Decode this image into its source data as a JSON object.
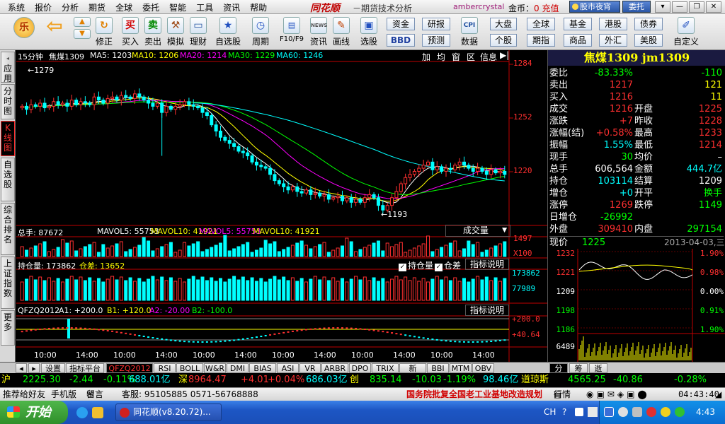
{
  "menubar": {
    "items": [
      "系统",
      "报价",
      "分析",
      "期货",
      "全球",
      "委托",
      "智能",
      "工具",
      "资讯",
      "帮助"
    ],
    "brand": "同花顺",
    "subtitle": "－期货技术分析",
    "user": "ambercrystal",
    "gold_label": "金币：",
    "gold_value": "0 充值",
    "night_btn": "股市夜宵",
    "entrust_btn": "委托",
    "win_buttons": [
      "▾",
      "—",
      "❐",
      "✕"
    ]
  },
  "toolbar": {
    "buttons": [
      {
        "label": "",
        "icon": "le-logo"
      },
      {
        "label": "",
        "icon": "back-arrow"
      },
      {
        "label": "",
        "icon": "up-down-arrows"
      },
      {
        "label": "修正",
        "icon": "refresh"
      },
      {
        "label": "买入",
        "icon": "buy"
      },
      {
        "label": "卖出",
        "icon": "sell"
      },
      {
        "label": "模拟",
        "icon": "hammer"
      },
      {
        "label": "理财",
        "icon": "card"
      },
      {
        "label": "自选股",
        "icon": "star"
      },
      {
        "label": "周期",
        "icon": "clock"
      },
      {
        "label": "F10/F9",
        "icon": "f10"
      },
      {
        "label": "资讯",
        "icon": "news"
      },
      {
        "label": "画线",
        "icon": "pencil"
      },
      {
        "label": "选股",
        "icon": "filter"
      },
      {
        "label": "数据",
        "icon": "cpi"
      },
      {
        "label": "自定义",
        "icon": "custom"
      }
    ],
    "small_buttons": [
      "资金",
      "研报",
      "BBD",
      "预测",
      "大盘",
      "全球",
      "基金",
      "港股",
      "债券",
      "个股",
      "期指",
      "商品",
      "外汇",
      "美股"
    ],
    "cpi_text": "CPI",
    "news_text": "NEWS"
  },
  "left_tabs": [
    "应用",
    "分时图",
    "K线图",
    "自选股",
    "综合排名",
    "上证指数",
    "更多"
  ],
  "chart": {
    "period": "15分钟",
    "symbol": "焦煤1309",
    "ma": [
      {
        "label": "MA5: 1203",
        "color": "#ffffff"
      },
      {
        "label": "MA10: 1206",
        "color": "#ffff00"
      },
      {
        "label": "MA20: 1214",
        "color": "#ff00ff"
      },
      {
        "label": "MA30: 1229",
        "color": "#00ff00"
      },
      {
        "label": "MA60: 1246",
        "color": "#00ffff"
      }
    ],
    "tool_buttons": [
      "加",
      "均",
      "窗",
      "区",
      "信息"
    ],
    "price_axis": [
      "1284",
      "1252",
      "1220"
    ],
    "high_mark": "1279",
    "low_mark": "1193",
    "vol_header": "总手: 87672",
    "vol_mavol5": "MAVOL5: 55753",
    "vol_mavol10": "MAVOL10: 41921",
    "vol_mavol5b": "MAVOL5: 55753",
    "vol_mavol10b": "MAVOL10: 41921",
    "vol_select": "成交量",
    "vol_axis": [
      "1497",
      "X100"
    ],
    "oi_header": "持仓量: 173862",
    "oi_diff": "仓差: 13652",
    "oi_check1": "持仓量",
    "oi_check2": "仓差",
    "oi_help": "指标说明",
    "oi_axis": [
      "173862",
      "77989"
    ],
    "ind_header": "QFZQ2012",
    "ind_a1": "A1: +200.0",
    "ind_b1": "B1: +120.0",
    "ind_a2": "A2: -20.00",
    "ind_b2": "B2: -100.0",
    "ind_help": "指标说明",
    "ind_axis": [
      "+200.0",
      "+40.64"
    ],
    "time_labels": [
      "10:00",
      "14:00",
      "10:00",
      "14:00",
      "10:00",
      "14:00",
      "10:00",
      "14:00",
      "10:00",
      "14:00",
      "10:00",
      "14:00"
    ]
  },
  "chart_data": {
    "type": "candlestick",
    "title": "焦煤1309 15分钟",
    "y_range": [
      1186,
      1290
    ],
    "high": 1279,
    "low": 1193,
    "closes": [
      1262,
      1260,
      1263,
      1262,
      1264,
      1261,
      1262,
      1265,
      1263,
      1264,
      1262,
      1266,
      1263,
      1265,
      1264,
      1263,
      1268,
      1266,
      1264,
      1267,
      1268,
      1266,
      1269,
      1268,
      1267,
      1270,
      1268,
      1266,
      1264,
      1262,
      1264,
      1258,
      1262,
      1260,
      1262,
      1263,
      1265,
      1263,
      1262,
      1261,
      1258,
      1256,
      1250,
      1246,
      1242,
      1240,
      1238,
      1236,
      1233,
      1232,
      1230,
      1226,
      1224,
      1223,
      1222,
      1218,
      1214,
      1212,
      1210,
      1208,
      1210,
      1207,
      1206,
      1208,
      1205,
      1206,
      1204,
      1205,
      1202,
      1203,
      1204,
      1201,
      1203,
      1200,
      1202,
      1200,
      1203,
      1205,
      1203,
      1198,
      1195,
      1198,
      1203,
      1207,
      1212,
      1216,
      1218,
      1220,
      1222,
      1224,
      1226,
      1221,
      1223,
      1220,
      1222,
      1221,
      1224,
      1226,
      1224,
      1222,
      1220,
      1222,
      1220,
      1218,
      1221,
      1219,
      1220,
      1218
    ],
    "volume_last": 87672,
    "open_interest_last": 173862
  },
  "quote": {
    "title": "焦煤1309 jm1309",
    "rows": [
      {
        "l": "委比",
        "v": "-83.33%",
        "vc": "#00ff00",
        "l2": "",
        "v2": "-110",
        "v2c": "#00ff00"
      },
      {
        "l": "卖出",
        "v": "1217",
        "vc": "#ff3030",
        "l2": "",
        "v2": "121",
        "v2c": "#ffff00"
      },
      {
        "l": "买入",
        "v": "1216",
        "vc": "#ff3030",
        "l2": "",
        "v2": "11",
        "v2c": "#ffff00"
      },
      {
        "l": "成交",
        "v": "1216",
        "vc": "#ff3030",
        "l2": "开盘",
        "v2": "1225",
        "v2c": "#ff3030"
      },
      {
        "l": "涨跌",
        "v": "+7",
        "vc": "#ff3030",
        "l2": "昨收",
        "v2": "1228",
        "v2c": "#ff3030"
      },
      {
        "l": "涨幅(结)",
        "v": "+0.58%",
        "vc": "#ff3030",
        "l2": "最高",
        "v2": "1233",
        "v2c": "#ff3030"
      },
      {
        "l": "振幅",
        "v": "1.55%",
        "vc": "#00ffff",
        "l2": "最低",
        "v2": "1214",
        "v2c": "#ff3030"
      },
      {
        "l": "现手",
        "v": "30",
        "vc": "#00ff00",
        "l2": "均价",
        "v2": "–",
        "v2c": "#ffffff"
      },
      {
        "l": "总手",
        "v": "606,564",
        "vc": "#ffffff",
        "l2": "金额",
        "v2": "444.7亿",
        "v2c": "#00ffff"
      },
      {
        "l": "持仓",
        "v": "103114",
        "vc": "#00ffff",
        "l2": "结算",
        "v2": "1209",
        "v2c": "#ffffff"
      },
      {
        "l": "增仓",
        "v": "+0",
        "vc": "#00ffff",
        "l2": "开平",
        "v2": "换手",
        "v2c": "#00ff00"
      },
      {
        "l": "涨停",
        "v": "1269",
        "vc": "#ff3030",
        "l2": "跌停",
        "v2": "1149",
        "v2c": "#00ff00"
      },
      {
        "l": "日增仓",
        "v": "-26992",
        "vc": "#00ff00",
        "l2": "",
        "v2": "",
        "v2c": "#ffffff"
      },
      {
        "l": "外盘",
        "v": "309410",
        "vc": "#ff3030",
        "l2": "内盘",
        "v2": "297154",
        "v2c": "#00ff00"
      }
    ],
    "price_label": "现价",
    "price_value": "1225",
    "date": "2013-04-03,三",
    "mini_axis_left": [
      "1232",
      "1221",
      "1209",
      "1198",
      "1186",
      "6489"
    ],
    "mini_axis_right": [
      "1.90%",
      "0.98%",
      "0.00%",
      "0.91%",
      "1.90%"
    ]
  },
  "tabstrip": {
    "left": [
      "设置",
      "指标平台"
    ],
    "tabs": [
      "QFZQ2012",
      "RSI",
      "BOLL",
      "W&R",
      "DMI",
      "BIAS",
      "ASI",
      "VR",
      "ARBR",
      "DPO",
      "TRIX",
      "新DMA",
      "BBI",
      "MTM",
      "OBV"
    ],
    "right": [
      "分",
      "筹",
      "逝"
    ]
  },
  "ticker": {
    "items": [
      {
        "t": "沪",
        "c": "#ffff00"
      },
      {
        "t": "2225.30",
        "c": "#00ff00"
      },
      {
        "t": "-2.44",
        "c": "#00ff00"
      },
      {
        "t": "-0.11%",
        "c": "#00ff00"
      },
      {
        "t": "688.01亿",
        "c": "#00ffff"
      },
      {
        "t": "深",
        "c": "#ffff00"
      },
      {
        "t": "8964.47",
        "c": "#ff3030"
      },
      {
        "t": "+4.01",
        "c": "#ff3030"
      },
      {
        "t": "+0.04%",
        "c": "#ff3030"
      },
      {
        "t": "686.03亿",
        "c": "#00ffff"
      },
      {
        "t": "创",
        "c": "#ffff00"
      },
      {
        "t": "835.14",
        "c": "#00ff00"
      },
      {
        "t": "-10.03",
        "c": "#00ff00"
      },
      {
        "t": "-1.19%",
        "c": "#00ff00"
      },
      {
        "t": "98.46亿",
        "c": "#00ffff"
      },
      {
        "t": "道琼斯",
        "c": "#ffff00"
      },
      {
        "t": "4565.25",
        "c": "#00ff00"
      },
      {
        "t": "-40.86",
        "c": "#00ff00"
      },
      {
        "t": "-0.28%",
        "c": "#00ff00"
      }
    ]
  },
  "statusbar": {
    "recommend": "推荐给好友",
    "mobile": "手机版",
    "message": "留言",
    "service": "客服: 95105885 0571-56768888",
    "news": "国务院批复全国老工业基地改造规划",
    "market": "行情",
    "time": "04:43:40"
  },
  "taskbar": {
    "start": "开始",
    "task": "同花顺(v8.20.72)...",
    "lang": "CH",
    "clock": "4:43"
  }
}
